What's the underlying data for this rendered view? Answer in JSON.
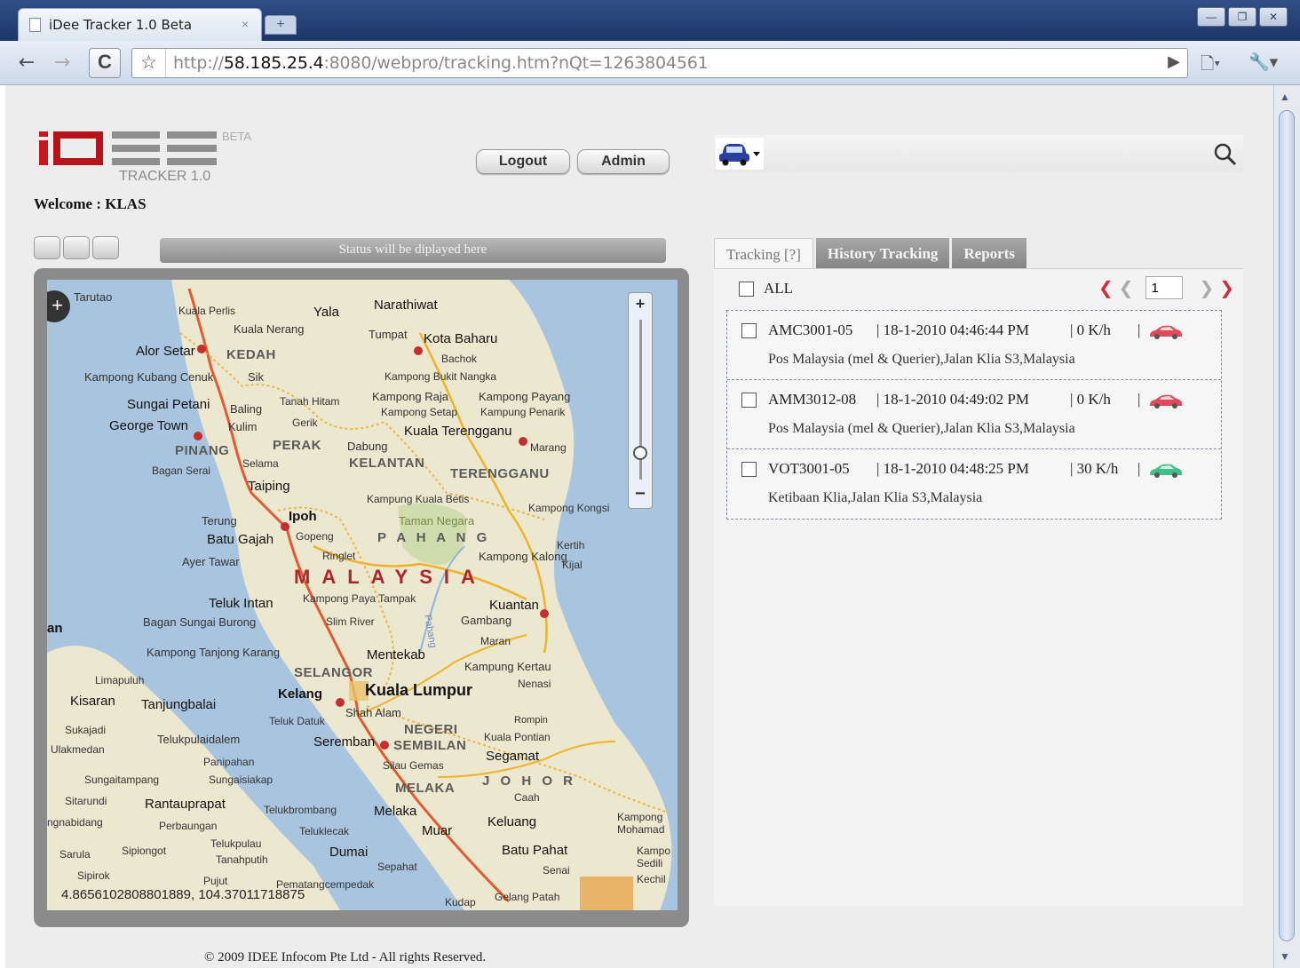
{
  "browser": {
    "tab_title": "iDee Tracker 1.0 Beta",
    "tab_close": "×",
    "url_prefix": "http://",
    "url_host": "58.185.25.4",
    "url_rest": ":8080/webpro/tracking.htm?nQt=1263804561",
    "icons": [
      "back-arrow-icon",
      "forward-arrow-icon",
      "reload-icon",
      "star-icon",
      "go-icon",
      "page-menu-icon",
      "wrench-icon"
    ]
  },
  "header": {
    "beta": "BETA",
    "tracker": "TRACKER 1.0",
    "welcome": "Welcome : KLAS",
    "logout_label": "Logout",
    "admin_label": "Admin"
  },
  "status": {
    "text": "Status will be diplayed here"
  },
  "map": {
    "coords": "4.8656102808801889, 104.37011718875",
    "labels": {
      "tarutao": "Tarutao",
      "yala": "Yala",
      "narathiwat": "Narathiwat",
      "kuala_perlis": "Kuala Perlis",
      "kuala_nerang": "Kuala Nerang",
      "tumpat": "Tumpat",
      "kota_baharu": "Kota Baharu",
      "bachok": "Bachok",
      "alor_setar": "Alor Setar",
      "kedah": "KEDAH",
      "kampong_kubang_cenuk": "Kampong Kubang Cenuk",
      "sik": "Sik",
      "kampong_bukit_nangka": "Kampong Bukit Nangka",
      "kampong_raja": "Kampong Raja",
      "kampong_payang": "Kampong Payang",
      "tanah_hitam": "Tanah Hitam",
      "sungai_petani": "Sungai Petani",
      "baling": "Baling",
      "kampong_setap": "Kampong Setap",
      "kampung_penarik": "Kampung Penarik",
      "gerik": "Gerik",
      "george_town": "George Town",
      "kulim": "Kulim",
      "kuala_terengganu": "Kuala Terengganu",
      "perak": "PERAK",
      "dabung": "Dabung",
      "marang": "Marang",
      "pinang": "PINANG",
      "selama": "Selama",
      "kelantan": "KELANTAN",
      "bagan_serai": "Bagan Serai",
      "terengganu": "TERENGGANU",
      "taiping": "Taiping",
      "kampung_kuala_betis": "Kampung Kuala Betis",
      "kampong_kongsi": "Kampong Kongsi",
      "terung": "Terung",
      "ipoh": "Ipoh",
      "taman_negara": "Taman Negara",
      "batu_gajah": "Batu Gajah",
      "gopeng": "Gopeng",
      "pahang": "P A H A N G",
      "kerteh": "Kertih",
      "ayer_tawar": "Ayer Tawar",
      "ringlet": "Ringlet",
      "kampong_kalong": "Kampong Kalong",
      "kijal": "Kijal",
      "malaysia": "MALAYSIA",
      "teluk_intan": "Teluk Intan",
      "kampong_paya_tampak": "Kampong Paya Tampak",
      "kuantan": "Kuantan",
      "bagan_sungai_burong": "Bagan Sungai Burong",
      "slim_river": "Slim River",
      "gambang": "Gambang",
      "an": "an",
      "maran": "Maran",
      "kampong_tanjong_karang": "Kampong Tanjong Karang",
      "mentekab": "Mentekab",
      "kampung_kertau": "Kampung Kertau",
      "selangor": "SELANGOR",
      "limapuluh": "Limapuluh",
      "nenasi": "Nenasi",
      "kisaran": "Kisaran",
      "tanjungbalai": "Tanjungbalai",
      "kelang": "Kelang",
      "kuala_lumpur": "Kuala Lumpur",
      "shah_alam": "Shah Alam",
      "sukajadi": "Sukajadi",
      "teluk_datuk": "Teluk Datuk",
      "negeri": "NEGERI",
      "rompin": "Rompin",
      "telukpulaidalem": "Telukpulaidalem",
      "seremban": "Seremban",
      "sembilan": "SEMBILAN",
      "kuala_pontian": "Kuala Pontian",
      "ulakmedan": "Ulakmedan",
      "panipahan": "Panipahan",
      "segamat": "Segamat",
      "silau_gemas": "Silau Gemas",
      "sungaitampang": "Sungaitampang",
      "sungaisiakap": "Sungaisiakap",
      "johor": "J O H O R",
      "melaka_state": "MELAKA",
      "caah": "Caah",
      "sitarundi": "Sitarundi",
      "rantauprapat": "Rantauprapat",
      "telukbrombang": "Telukbrombang",
      "melaka": "Melaka",
      "muar": "Muar",
      "kampong_mohamad": "Kampong Mohamad",
      "ngnabidang": "ngnabidang",
      "perbaungan": "Perbaungan",
      "teluklecak": "Teluklecak",
      "keluang": "Keluang",
      "sarula": "Sarula",
      "sipiongot": "Sipiongot",
      "telukpulau": "Telukpulau",
      "tanahputih": "Tanahputih",
      "dumai": "Dumai",
      "batu_pahat": "Batu Pahat",
      "kampo_sedili": "Kampo Sedili",
      "sepahat": "Sepahat",
      "senai": "Senai",
      "kechil": "Kechil",
      "sipirok": "Sipirok",
      "pujut": "Pujut",
      "pematangcempedak": "Pematangcempedak",
      "kudap": "Kudap",
      "gelang_patah": "Gelang Patah",
      "pahang_river": "Pahang",
      "tarutao_pin": "Tarutao"
    }
  },
  "panel": {
    "tabs": [
      {
        "label": "Tracking [?]",
        "active": true
      },
      {
        "label": "History Tracking",
        "active": false
      },
      {
        "label": "Reports",
        "active": false
      }
    ],
    "all_label": "ALL",
    "page_number": "1",
    "vehicles": [
      {
        "plate": "AMC3001-05",
        "time": "| 18-1-2010 04:46:44 PM",
        "speed": "| 0 K/h",
        "sep": "|",
        "address": "Pos Malaysia (mel & Querier),Jalan Klia S3,Malaysia",
        "car_color": "#e04a5a"
      },
      {
        "plate": "AMM3012-08",
        "time": "| 18-1-2010 04:49:02 PM",
        "speed": "| 0 K/h",
        "sep": "|",
        "address": "Pos Malaysia (mel & Querier),Jalan Klia S3,Malaysia",
        "car_color": "#e04a5a"
      },
      {
        "plate": "VOT3001-05",
        "time": "| 18-1-2010 04:48:25 PM",
        "speed": "| 30 K/h",
        "sep": "|",
        "address": "Ketibaan Klia,Jalan Klia S3,Malaysia",
        "car_color": "#3fbf8a"
      }
    ]
  },
  "footer": {
    "text": "© 2009 IDEE Infocom Pte Ltd - All rights Reserved."
  }
}
